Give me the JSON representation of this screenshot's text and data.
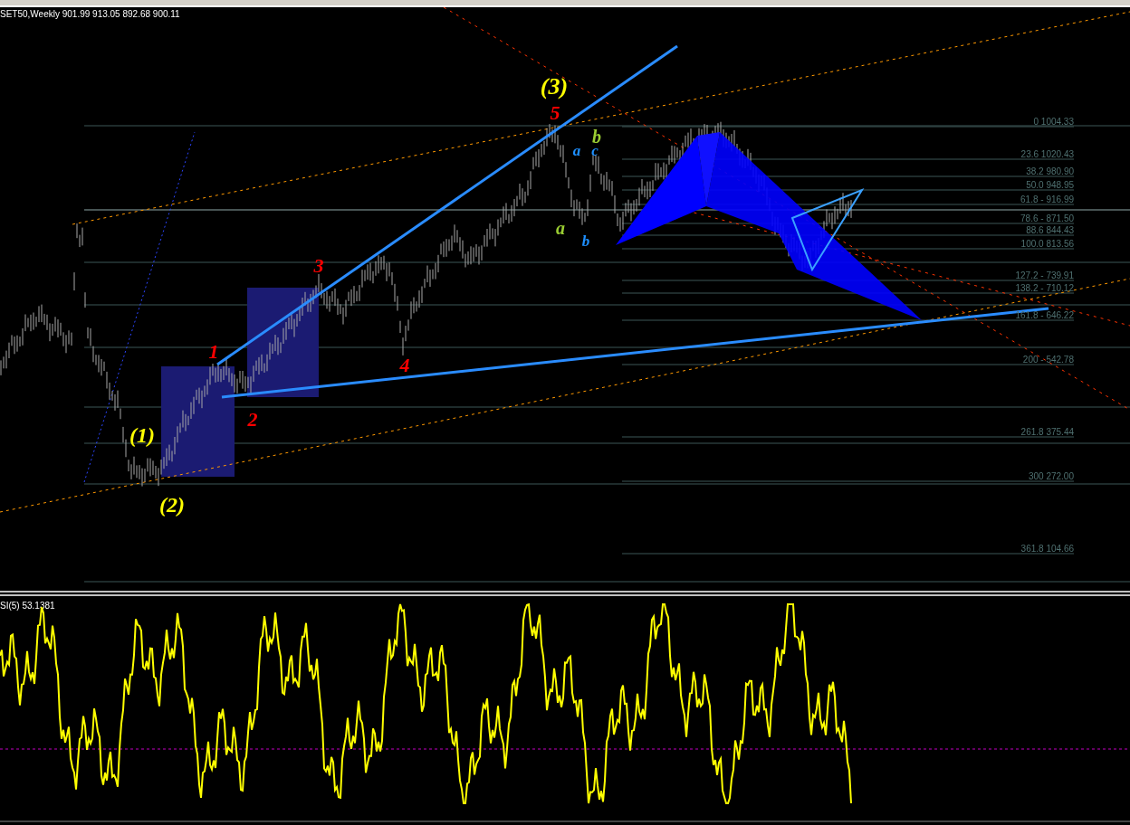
{
  "chart": {
    "header": "SET50,Weekly  901.99 913.05 892.68 900.11",
    "wave_labels": [
      {
        "text": "(3)",
        "color": "#ffff00"
      },
      {
        "text": "5",
        "color": "#ff0000"
      },
      {
        "text": "3",
        "color": "#ff0000"
      },
      {
        "text": "1",
        "color": "#ff0000"
      },
      {
        "text": "4",
        "color": "#ff0000"
      },
      {
        "text": "2",
        "color": "#ff0000"
      },
      {
        "text": "(1)",
        "color": "#ffff00"
      },
      {
        "text": "(2)",
        "color": "#ffff00"
      },
      {
        "text": "b",
        "color": "#9acd32"
      },
      {
        "text": "a",
        "color": "#1e90ff"
      },
      {
        "text": "c",
        "color": "#1e90ff"
      },
      {
        "text": "a",
        "color": "#9acd32"
      },
      {
        "text": "b",
        "color": "#1e90ff"
      }
    ],
    "fib_levels": [
      {
        "label": "0 1004.33"
      },
      {
        "label": "23.6 1020.43"
      },
      {
        "label": "38.2 980.90"
      },
      {
        "label": "50.0 948.95"
      },
      {
        "label": "61.8 - 916.99"
      },
      {
        "label": "78.6 - 871.50"
      },
      {
        "label": "88.6 844.43"
      },
      {
        "label": "100.0 813.56"
      },
      {
        "label": "127.2 - 739.91"
      },
      {
        "label": "138.2 - 710.12"
      },
      {
        "label": "161.8 -  646.22"
      },
      {
        "label": "200 - 542.78"
      },
      {
        "label": "261.8 375.44"
      },
      {
        "label": "300 272.00"
      },
      {
        "label": "361.8 104.66"
      }
    ]
  },
  "indicator": {
    "header": "SI(5) 53.1381"
  }
}
